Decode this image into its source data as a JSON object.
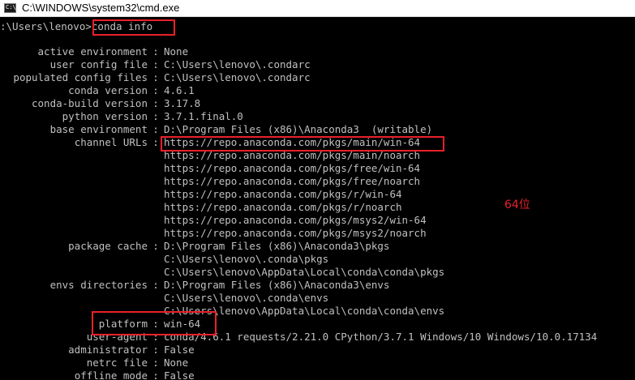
{
  "window": {
    "title": "C:\\WINDOWS\\system32\\cmd.exe",
    "icon": "cmd-console-icon",
    "icon_glyph": "C:\\"
  },
  "console": {
    "prompt": ":\\Users\\lenovo>",
    "command": "conda info",
    "rows": [
      {
        "label": "active environment",
        "value": "None"
      },
      {
        "label": "user config file",
        "value": "C:\\Users\\lenovo\\.condarc"
      },
      {
        "label": "populated config files",
        "value": "C:\\Users\\lenovo\\.condarc"
      },
      {
        "label": "conda version",
        "value": "4.6.1"
      },
      {
        "label": "conda-build version",
        "value": "3.17.8"
      },
      {
        "label": "python version",
        "value": "3.7.1.final.0"
      },
      {
        "label": "base environment",
        "value": "D:\\Program Files (x86)\\Anaconda3  (writable)"
      },
      {
        "label": "channel URLs",
        "value": "https://repo.anaconda.com/pkgs/main/win-64"
      },
      {
        "label": "",
        "value": "https://repo.anaconda.com/pkgs/main/noarch"
      },
      {
        "label": "",
        "value": "https://repo.anaconda.com/pkgs/free/win-64"
      },
      {
        "label": "",
        "value": "https://repo.anaconda.com/pkgs/free/noarch"
      },
      {
        "label": "",
        "value": "https://repo.anaconda.com/pkgs/r/win-64"
      },
      {
        "label": "",
        "value": "https://repo.anaconda.com/pkgs/r/noarch"
      },
      {
        "label": "",
        "value": "https://repo.anaconda.com/pkgs/msys2/win-64"
      },
      {
        "label": "",
        "value": "https://repo.anaconda.com/pkgs/msys2/noarch"
      },
      {
        "label": "package cache",
        "value": "D:\\Program Files (x86)\\Anaconda3\\pkgs"
      },
      {
        "label": "",
        "value": "C:\\Users\\lenovo\\.conda\\pkgs"
      },
      {
        "label": "",
        "value": "C:\\Users\\lenovo\\AppData\\Local\\conda\\conda\\pkgs"
      },
      {
        "label": "envs directories",
        "value": "D:\\Program Files (x86)\\Anaconda3\\envs"
      },
      {
        "label": "",
        "value": "C:\\Users\\lenovo\\.conda\\envs"
      },
      {
        "label": "",
        "value": "C:\\Users\\lenovo\\AppData\\Local\\conda\\conda\\envs"
      },
      {
        "label": "platform",
        "value": "win-64"
      },
      {
        "label": "user-agent",
        "value": "conda/4.6.1 requests/2.21.0 CPython/3.7.1 Windows/10 Windows/10.0.17134"
      },
      {
        "label": "administrator",
        "value": "False"
      },
      {
        "label": "netrc file",
        "value": "None"
      },
      {
        "label": "offline mode",
        "value": "False"
      }
    ]
  },
  "annotation": {
    "text": "64位",
    "color": "#e8212a"
  },
  "colors": {
    "console_bg": "#000000",
    "console_text": "#c0c0c0",
    "highlight": "#e8212a"
  }
}
